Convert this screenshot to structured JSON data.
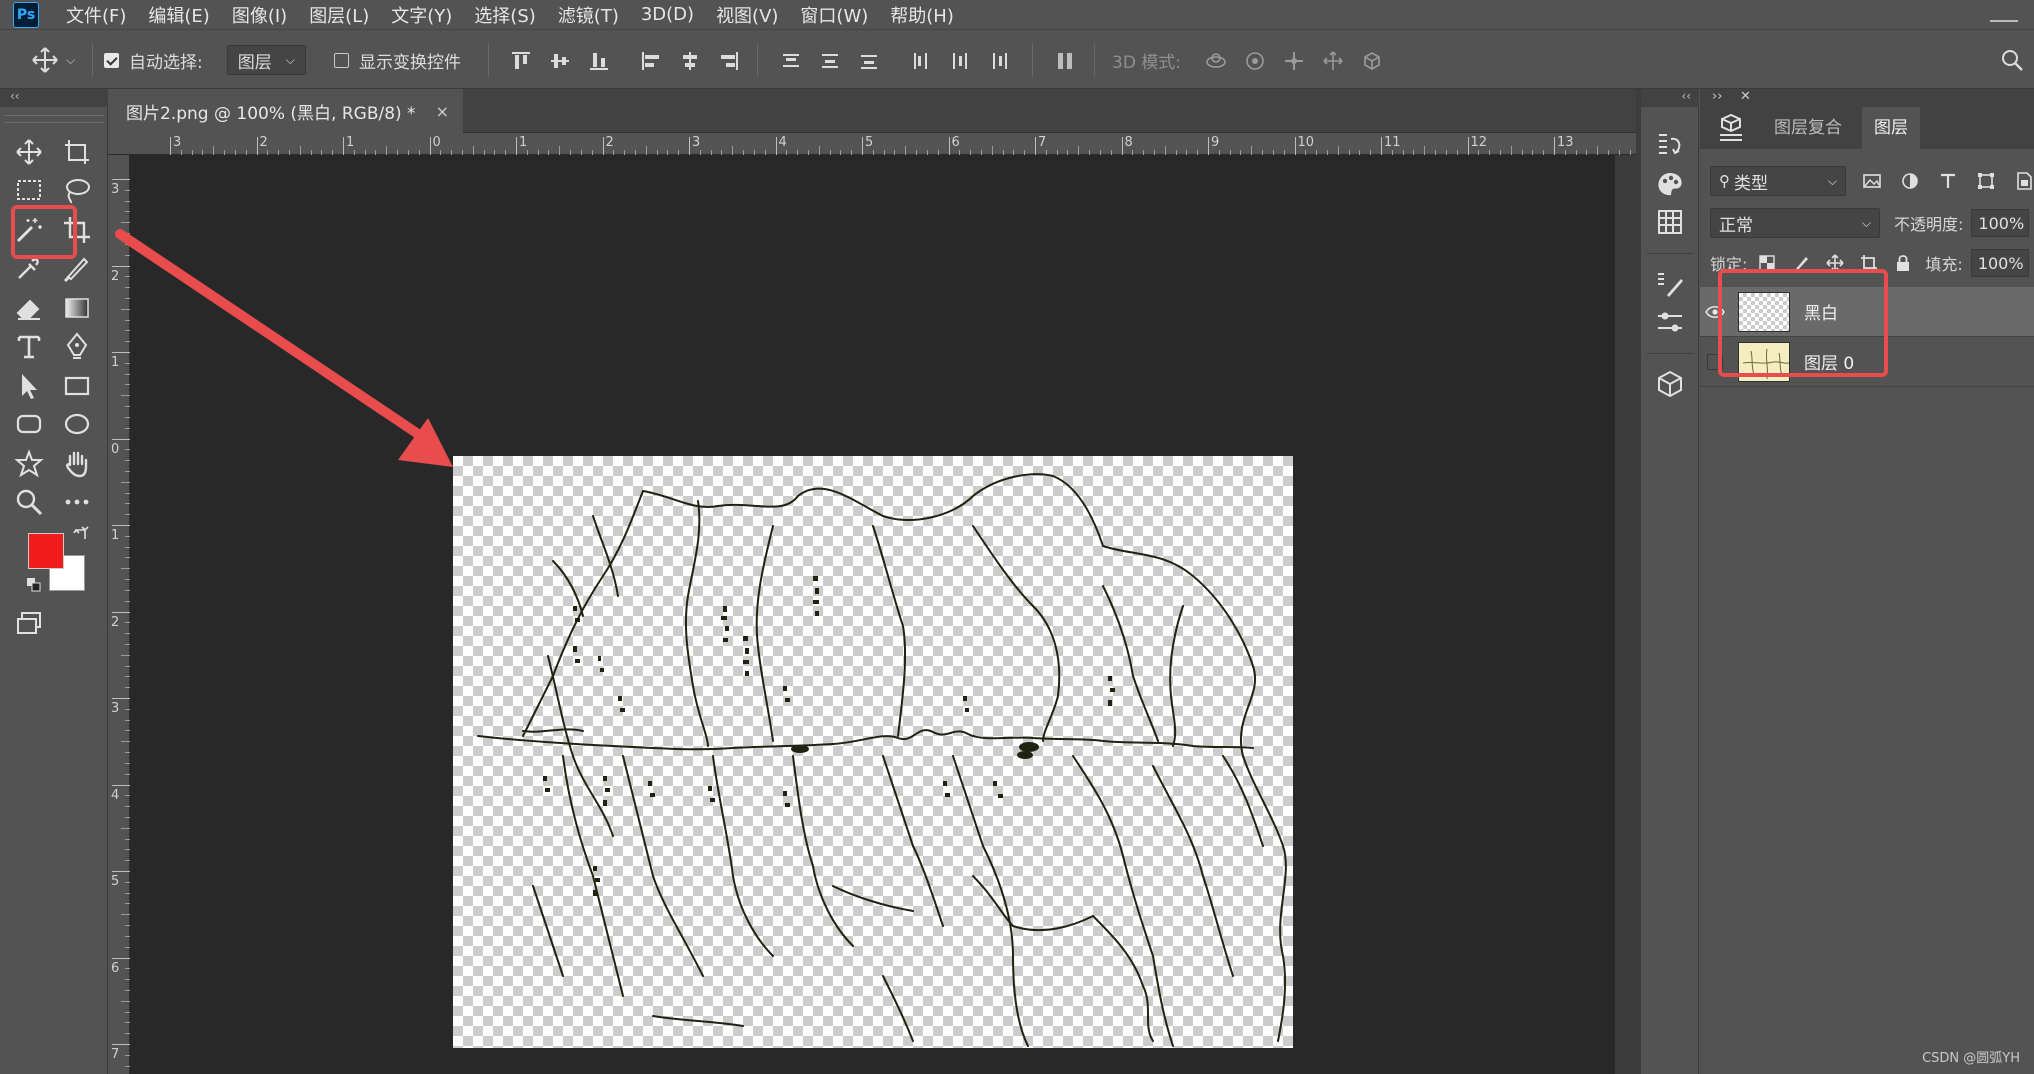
{
  "app": {
    "logo": "Ps"
  },
  "menu": [
    "文件(F)",
    "编辑(E)",
    "图像(I)",
    "图层(L)",
    "文字(Y)",
    "选择(S)",
    "滤镜(T)",
    "3D(D)",
    "视图(V)",
    "窗口(W)",
    "帮助(H)"
  ],
  "options_bar": {
    "auto_select_label": "自动选择:",
    "auto_select_checked": true,
    "auto_select_target": "图层",
    "show_transform_label": "显示变换控件",
    "show_transform_checked": false,
    "mode_3d_label": "3D 模式:"
  },
  "toolbar": {
    "collapse": "‹‹",
    "foreground_color": "#f21b1b",
    "background_color": "#ffffff",
    "highlight_tool": "magic-wand-icon"
  },
  "document": {
    "tab_title": "图片2.png @ 100% (黑白, RGB/8) *",
    "close": "×",
    "ruler_top_labels": [
      "3",
      "2",
      "1",
      "0",
      "1",
      "2",
      "3",
      "4",
      "5",
      "6",
      "7",
      "8",
      "9",
      "10",
      "11",
      "12",
      "13"
    ],
    "ruler_left_labels": [
      "3",
      "2",
      "1",
      "0",
      "1",
      "2",
      "3",
      "4",
      "5",
      "6",
      "7"
    ]
  },
  "dock": {
    "collapse": "‹‹"
  },
  "layers_panel": {
    "header_expand": "››",
    "header_close": "✕",
    "tabs": [
      "图层复合",
      "图层"
    ],
    "active_tab": "图层",
    "filter_label": "类型",
    "blend_mode": "正常",
    "opacity_label": "不透明度:",
    "opacity_value": "100%",
    "lock_label": "锁定:",
    "fill_label": "填充:",
    "fill_value": "100%",
    "layers": [
      {
        "name": "黑白",
        "visible": true,
        "selected": true
      },
      {
        "name": "图层 0",
        "visible": false,
        "selected": false
      }
    ]
  },
  "annotation_color": "#e84c4c",
  "watermark": "CSDN @圆弧YH"
}
